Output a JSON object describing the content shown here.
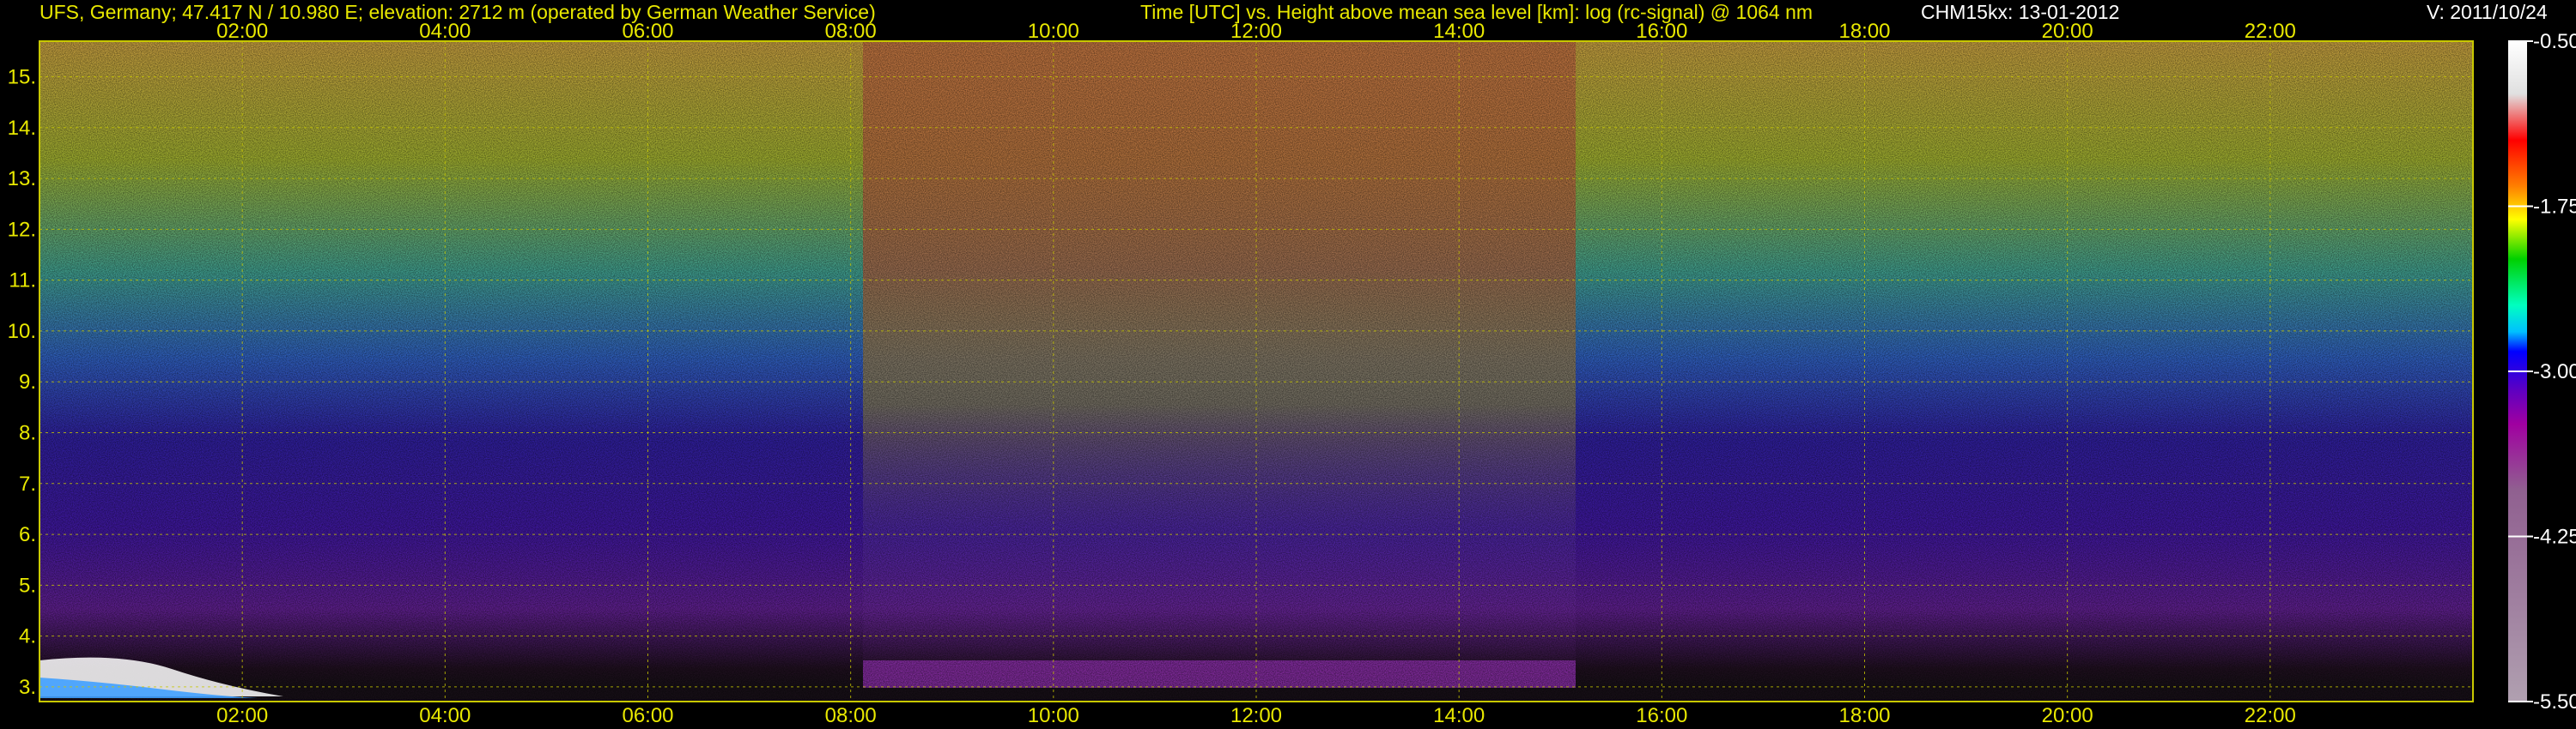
{
  "header": {
    "station_info": "UFS, Germany; 47.417 N / 10.980 E; elevation: 2712 m  (operated by German Weather Service)",
    "plot_title": "Time [UTC] vs. Height above mean sea level [km]: log (rc-signal) @ 1064 nm",
    "instrument_date": "CHM15kx: 13-01-2012",
    "version": "V: 2011/10/24"
  },
  "chart_data": {
    "type": "heatmap",
    "title": "Time [UTC] vs. Height above mean sea level [km]: log (rc-signal) @ 1064 nm",
    "x_range": [
      0,
      24
    ],
    "x_ticks": [
      "02:00",
      "04:00",
      "06:00",
      "08:00",
      "10:00",
      "12:00",
      "14:00",
      "16:00",
      "18:00",
      "20:00",
      "22:00"
    ],
    "x_tick_values": [
      2,
      4,
      6,
      8,
      10,
      12,
      14,
      16,
      18,
      20,
      22
    ],
    "y_range": [
      2.712,
      15.7
    ],
    "y_ticks": [
      "3.",
      "4.",
      "5.",
      "6.",
      "7.",
      "8.",
      "9.",
      "10.",
      "11.",
      "12.",
      "13.",
      "14.",
      "15."
    ],
    "y_tick_values": [
      3,
      4,
      5,
      6,
      7,
      8,
      9,
      10,
      11,
      12,
      13,
      14,
      15
    ],
    "grid": true,
    "colorbar": {
      "range": [
        -5.5,
        -0.5
      ],
      "ticks": [
        "-0.50",
        "-1.75",
        "-3.00",
        "-4.25",
        "-5.50"
      ],
      "tick_values": [
        -0.5,
        -1.75,
        -3.0,
        -4.25,
        -5.5
      ],
      "colors": [
        "#ffffff",
        "#e0e0e0",
        "#ff0000",
        "#ff8000",
        "#ffff00",
        "#c0ff00",
        "#00d000",
        "#00ffc0",
        "#00c0ff",
        "#0000ff",
        "#6000c0",
        "#a000a0",
        "#906090",
        "#a080a0",
        "#b0a0b0"
      ]
    }
  },
  "colors": {
    "text_yellow": "#e8e800",
    "text_white": "#ffffff",
    "grid": "#c8c800",
    "background": "#000000"
  }
}
